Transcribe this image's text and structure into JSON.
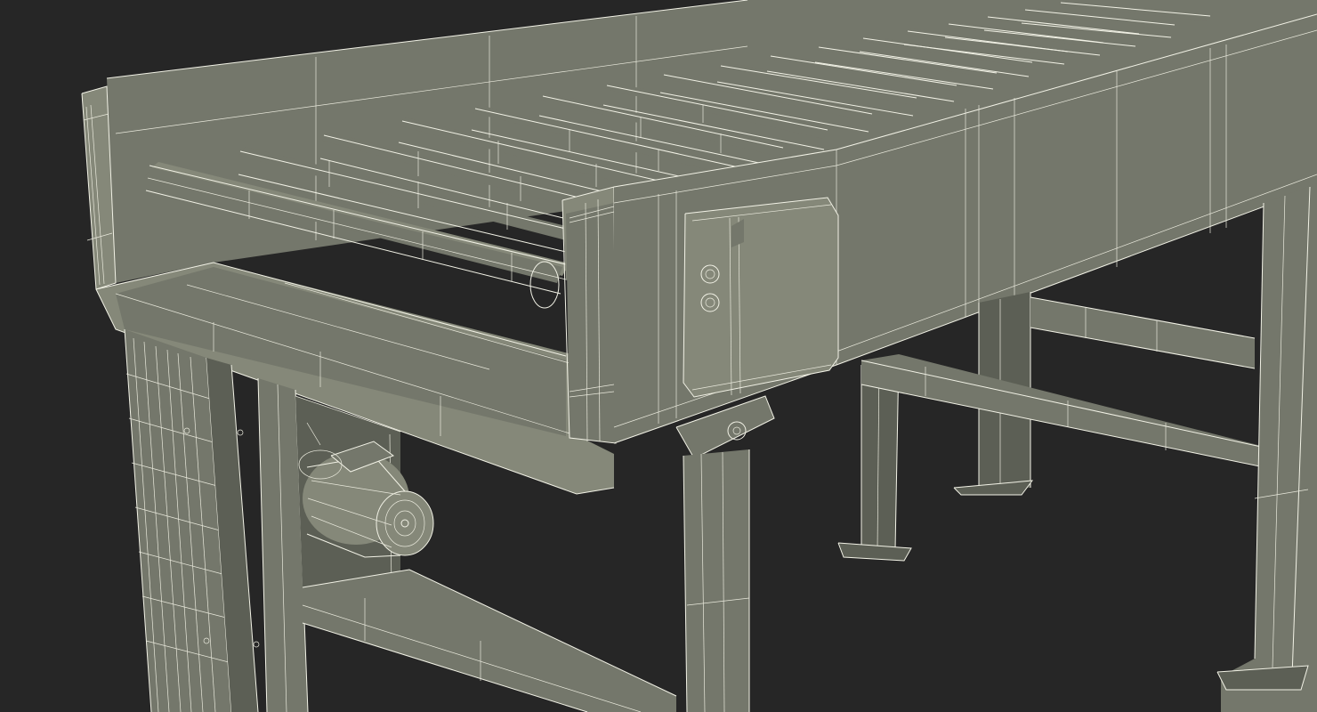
{
  "scene": {
    "background_color": "#262626",
    "wire_color": "#f2f2e6",
    "surface_dark": "#5c5f55",
    "surface_mid": "#74776b",
    "surface_light": "#858879"
  }
}
